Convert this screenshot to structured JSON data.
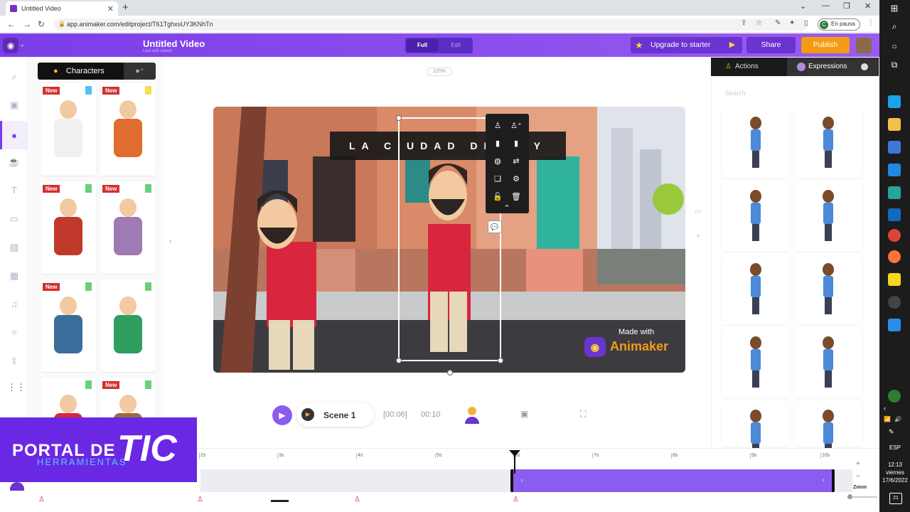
{
  "browser": {
    "tab_title": "Untitled Video",
    "url": "app.animaker.com/editproject/T61TghxsUY3KNhTn",
    "profile_status": "En pausa",
    "profile_initial": "C"
  },
  "header": {
    "title": "Untitled Video",
    "subtitle": "Last edit saved",
    "full_label": "Full",
    "edit_label": "Edit",
    "upgrade_label": "Upgrade to starter",
    "share_label": "Share",
    "publish_label": "Publish"
  },
  "characters_panel": {
    "tab_label": "Characters",
    "new_badge": "New",
    "cards": [
      {
        "name": "arab-man",
        "is_new": true,
        "flag_color": "#4fc3f7"
      },
      {
        "name": "worker",
        "is_new": true,
        "flag_color": "#f4e04d"
      },
      {
        "name": "farmer",
        "is_new": true,
        "flag_color": "#66d17a"
      },
      {
        "name": "elephant",
        "is_new": true,
        "flag_color": "#66d17a"
      },
      {
        "name": "bear",
        "is_new": true,
        "flag_color": "#66d17a"
      },
      {
        "name": "woman",
        "is_new": false,
        "flag_color": "#66d17a"
      },
      {
        "name": "bearded-man",
        "is_new": false,
        "flag_color": "#66d17a"
      },
      {
        "name": "old-man",
        "is_new": true,
        "flag_color": "#66d17a"
      }
    ]
  },
  "stage": {
    "zoom": "125%",
    "title_text": "LA CIUDAD DE HOY",
    "watermark_line1": "Made with",
    "watermark_line2": "Animaker"
  },
  "scene_controls": {
    "scene_name": "Scene 1",
    "current_time": "[00:06]",
    "duration": "00:10"
  },
  "right_panel": {
    "actions_label": "Actions",
    "expressions_label": "Expressions",
    "search_placeholder": "Search"
  },
  "timeline": {
    "ticks": [
      "2s",
      "3s",
      "4s",
      "5s",
      "6s",
      "7s",
      "8s",
      "9s",
      "10s"
    ],
    "zoom_label": "Zoom"
  },
  "overlay": {
    "line1": "PORTAL DE",
    "line2": "TIC",
    "line3": "HERRAMIENTAS"
  },
  "taskbar": {
    "lang": "ESP",
    "time": "12:13",
    "day": "viernes",
    "date": "17/6/2022",
    "notif_count": "21"
  }
}
